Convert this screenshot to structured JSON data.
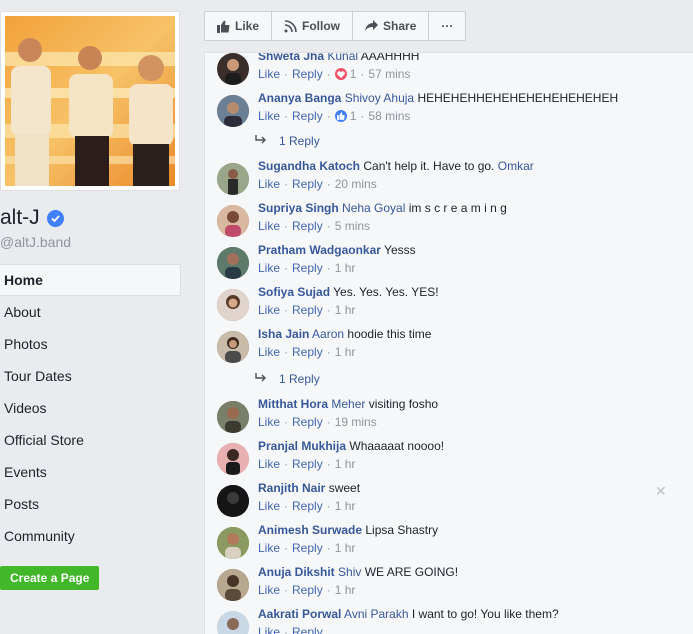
{
  "page": {
    "name": "alt-J",
    "handle": "@altJ.band",
    "create_page_label": "Create a Page"
  },
  "nav": [
    {
      "label": "Home",
      "active": true
    },
    {
      "label": "About"
    },
    {
      "label": "Photos"
    },
    {
      "label": "Tour Dates"
    },
    {
      "label": "Videos"
    },
    {
      "label": "Official Store"
    },
    {
      "label": "Events"
    },
    {
      "label": "Posts"
    },
    {
      "label": "Community"
    }
  ],
  "actions": {
    "like": "Like",
    "follow": "Follow",
    "share": "Share",
    "more": "···"
  },
  "comments": [
    {
      "author": "Shweta Jha",
      "mention": "Kunal",
      "text": "AAAHHHH",
      "reaction": {
        "type": "love",
        "count": "1",
        "color": "#f25268"
      },
      "time": "57 mins",
      "avatar_color": "#3a2e2a"
    },
    {
      "author": "Ananya Banga",
      "mention": "Shivoy Ahuja",
      "text": "HEHEHEHHEHEHEHEHEHEHEHEH",
      "reaction": {
        "type": "like",
        "count": "1",
        "color": "#4080ff"
      },
      "time": "58 mins",
      "avatar_color": "#5a6b7d",
      "replies": "1 Reply"
    },
    {
      "author": "Sugandha Katoch",
      "mention": "",
      "text": "Can't help it. Have to go. ",
      "trailing_mention": "Omkar",
      "time": "20 mins",
      "avatar_color": "#7c8a6a"
    },
    {
      "author": "Supriya Singh",
      "mention": "Neha Goyal",
      "text": "im s c r e a m i n g",
      "time": "5 mins",
      "avatar_color": "#a07a6a"
    },
    {
      "author": "Pratham Wadgaonkar",
      "mention": "",
      "text": "Yesss",
      "time": "1 hr",
      "avatar_color": "#4f6a5c"
    },
    {
      "author": "Sofiya Sujad",
      "mention": "",
      "text": "Yes. Yes. Yes. YES!",
      "time": "1 hr",
      "avatar_color": "#8a6a5c"
    },
    {
      "author": "Isha Jain",
      "mention": "Aaron",
      "text": "hoodie this time",
      "time": "1 hr",
      "avatar_color": "#5c4a3a",
      "replies": "1 Reply"
    },
    {
      "author": "Mitthat Hora",
      "mention": "Meher",
      "text": "visiting fosho",
      "time": "19 mins",
      "avatar_color": "#6a6f5a"
    },
    {
      "author": "Pranjal Mukhija",
      "mention": "",
      "text": "Whaaaaat noooo!",
      "time": "1 hr",
      "avatar_color": "#c98a8a"
    },
    {
      "author": "Ranjith Nair",
      "mention": "",
      "text": "sweet",
      "time": "1 hr",
      "avatar_color": "#1e1e1e"
    },
    {
      "author": "Animesh Surwade",
      "mention": "",
      "text": "Lipsa Shastry",
      "time": "1 hr",
      "avatar_color": "#6b7a4a"
    },
    {
      "author": "Anuja Dikshit",
      "mention": "Shiv",
      "text": "WE ARE GOING!",
      "time": "1 hr",
      "avatar_color": "#7a6a58"
    },
    {
      "author": "Aakrati Porwal",
      "mention": "Avni Parakh",
      "text": "I want to go! You like them?",
      "time": "",
      "avatar_color": "#a8b8c8"
    }
  ],
  "labels": {
    "like": "Like",
    "reply": "Reply"
  },
  "colors": {
    "link": "#365899",
    "verified": "#4080ff",
    "create_page": "#42b72a"
  }
}
